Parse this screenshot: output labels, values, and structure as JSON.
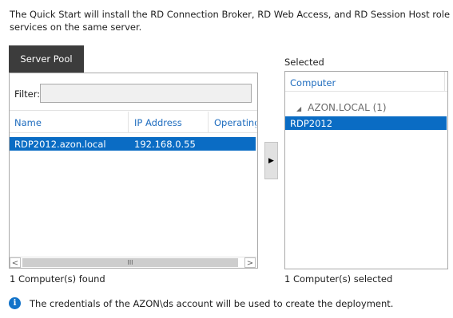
{
  "intro_text": "The Quick Start will install the RD Connection Broker, RD Web Access, and RD Session Host role services on the same server.",
  "server_pool": {
    "tab_label": "Server Pool",
    "filter_label": "Filter:",
    "filter_value": "",
    "columns": [
      "Name",
      "IP Address",
      "Operating"
    ],
    "rows": [
      {
        "name": "RDP2012.azon.local",
        "ip": "192.168.0.55",
        "os": ""
      }
    ],
    "status": "1 Computer(s) found",
    "scroll_left": "<",
    "scroll_right": ">",
    "scroll_grip": "III"
  },
  "move_button": {
    "glyph": "▶",
    "icon": "right-arrow-icon"
  },
  "selected": {
    "label": "Selected",
    "column": "Computer",
    "group": "AZON.LOCAL (1)",
    "group_glyph": "◢",
    "items": [
      "RDP2012"
    ],
    "status": "1 Computer(s) selected"
  },
  "info": {
    "icon": "info-icon",
    "glyph": "i",
    "text": "The credentials of the AZON\\ds account will be used to create the deployment."
  },
  "colors": {
    "selection": "#0a6cc4",
    "header_text": "#1f6dbf",
    "tab_bg": "#3c3c3c",
    "info": "#1273c9"
  }
}
